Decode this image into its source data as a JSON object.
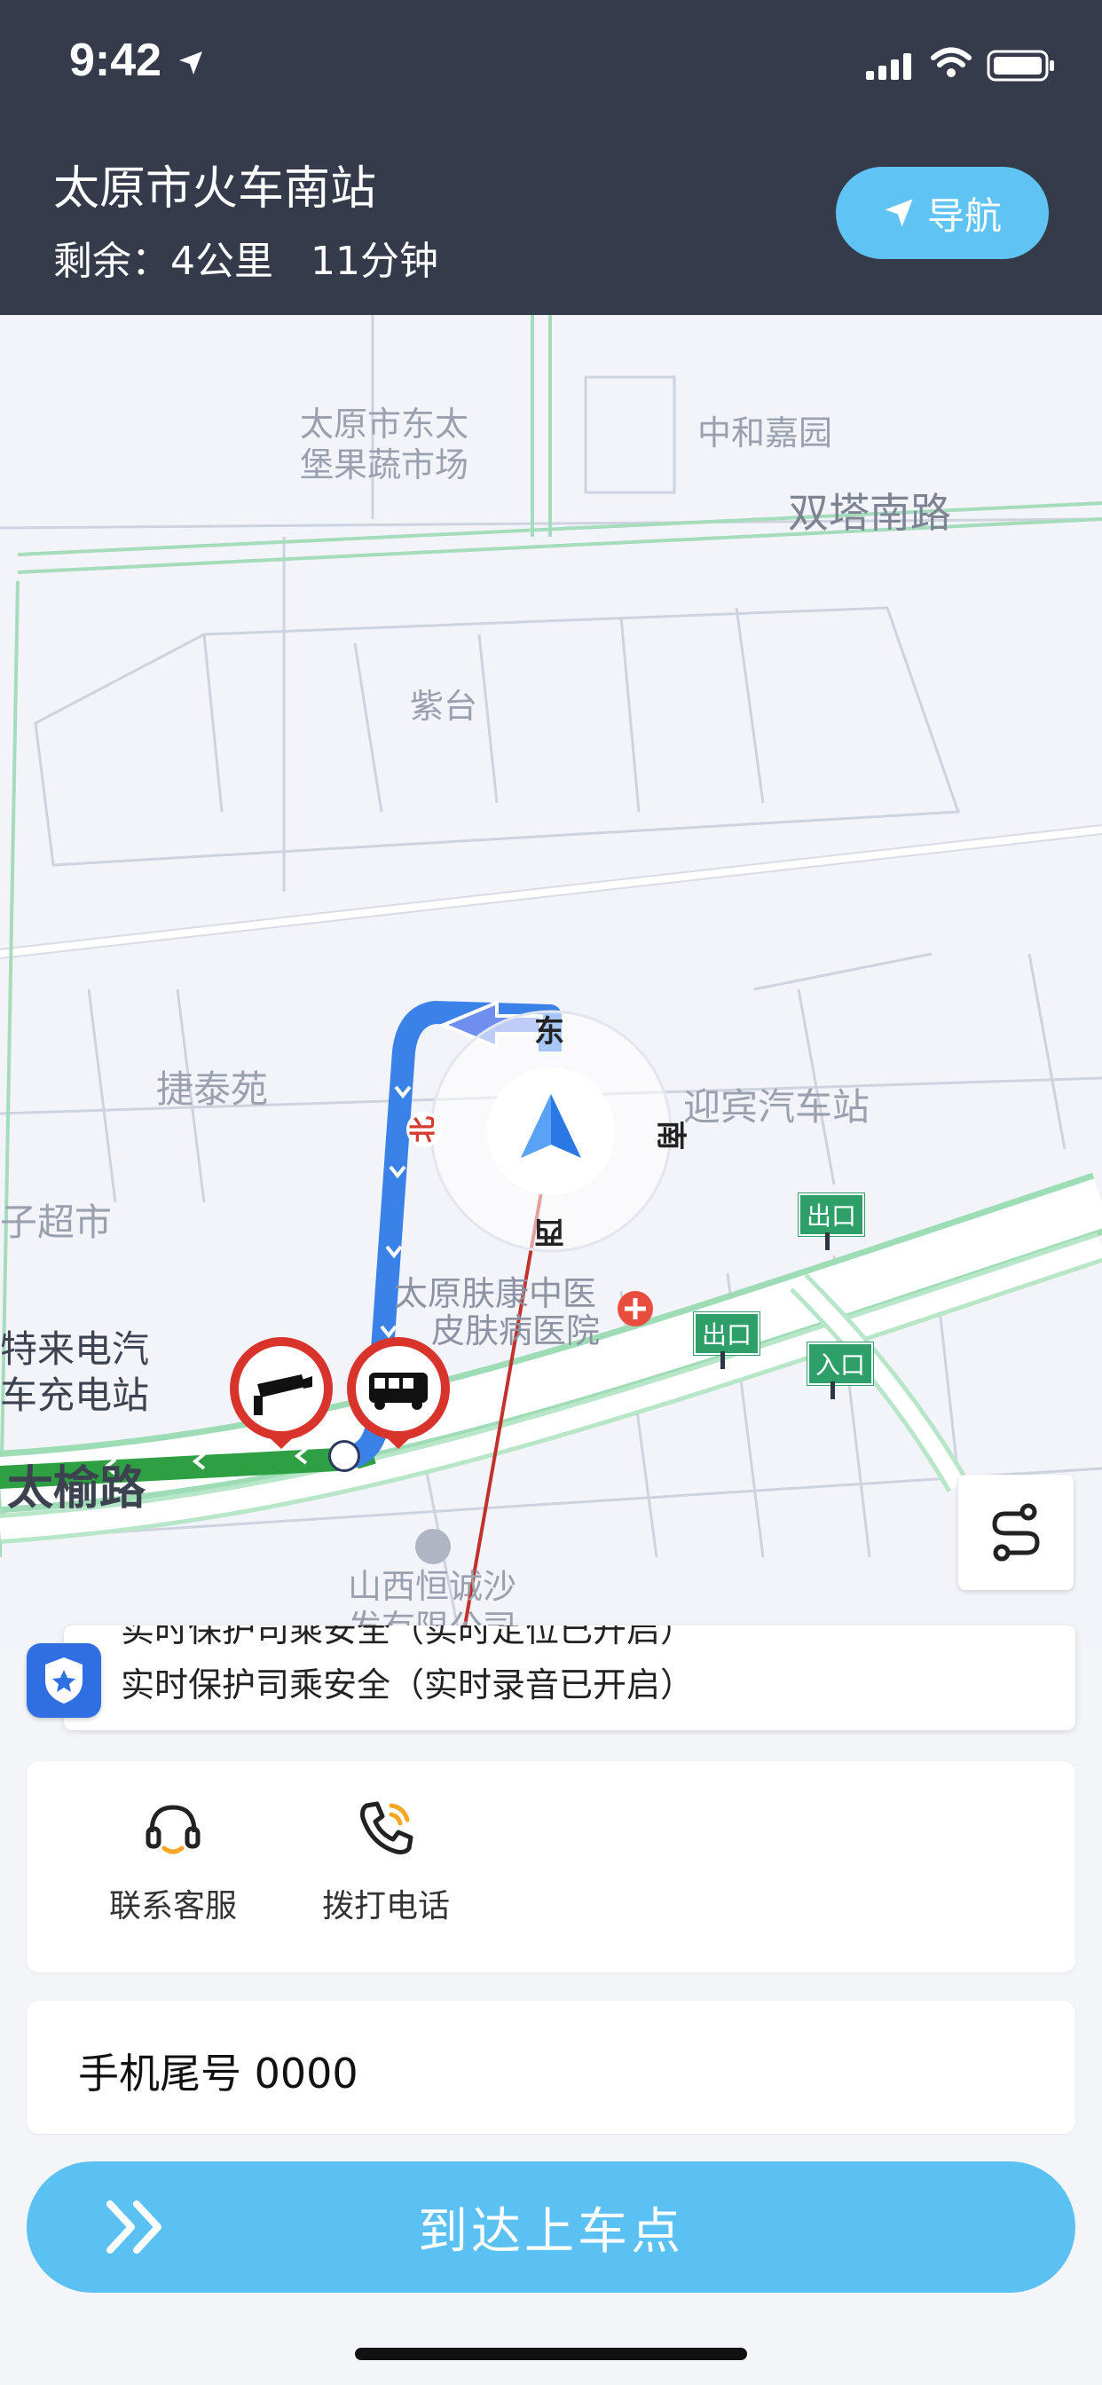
{
  "status_bar": {
    "time": "9:42"
  },
  "header": {
    "destination": "太原市火车南站",
    "remaining": "剩余：4公里   11分钟",
    "nav_button_label": "导航"
  },
  "map": {
    "labels": {
      "market": "太原市东太\n堡果蔬市场",
      "zhonghe": "中和嘉园",
      "shuangta": "双塔南路",
      "zitai": "紫台",
      "jietai": "捷泰苑",
      "yingbin": "迎宾汽车站",
      "hospital_line1": "太原肤康中医",
      "hospital_line2": "皮肤病医院",
      "supermarket": "子超市",
      "charging": "特来电汽\n车充电站",
      "taiyu": "太榆路",
      "shanxi": "山西恒诚沙",
      "shanxi_cut": "发有限公司"
    },
    "compass": {
      "north": "北",
      "east": "东",
      "south": "南",
      "west": "西"
    },
    "signs": {
      "exit1": "出口",
      "exit2": "出口",
      "entry": "入口"
    }
  },
  "security_notice": {
    "previous_text": "实时保护司乘安全（实时定位已开启）",
    "text": "实时保护司乘安全（实时录音已开启）"
  },
  "actions": [
    {
      "label": "联系客服",
      "icon": "headset-icon"
    },
    {
      "label": "拨打电话",
      "icon": "phone-call-icon"
    }
  ],
  "phone_tail": "手机尾号 0000",
  "arrive_button": {
    "label": "到达上车点"
  },
  "colors": {
    "header_bg": "#363b4c",
    "accent_blue": "#5bc1f2",
    "route_blue": "#3b82e8",
    "route_green": "#2ea043",
    "shield_blue": "#2f6fe2"
  }
}
